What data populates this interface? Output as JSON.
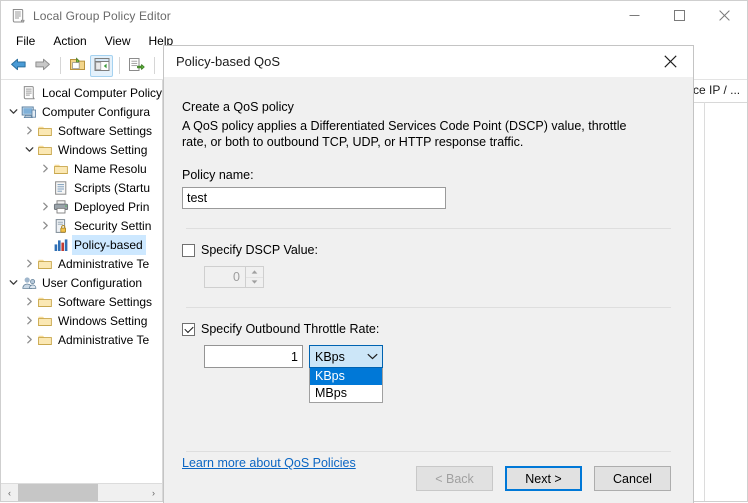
{
  "window": {
    "title": "Local Group Policy Editor",
    "icon": "policy-editor-icon",
    "controls": {
      "minimize": "minimize-icon",
      "maximize": "maximize-icon",
      "close": "close-icon"
    }
  },
  "menu": {
    "items": [
      {
        "label": "File"
      },
      {
        "label": "Action"
      },
      {
        "label": "View"
      },
      {
        "label": "Help"
      }
    ]
  },
  "toolbar": {
    "buttons": [
      {
        "name": "back-button",
        "icon": "back-arrow-icon"
      },
      {
        "name": "forward-button",
        "icon": "forward-arrow-icon"
      },
      {
        "name": "up-folder-button",
        "icon": "folder-up-icon"
      },
      {
        "name": "show-hide-console-tree-button",
        "icon": "console-tree-icon"
      },
      {
        "name": "export-list-button",
        "icon": "export-list-icon"
      },
      {
        "name": "help-button",
        "icon": "help-question-icon"
      }
    ]
  },
  "tree": {
    "items": [
      {
        "label": "Local Computer Policy",
        "indent": 0,
        "twisty": "none",
        "icon": "policy-scroll-icon",
        "selected": false
      },
      {
        "label": "Computer Configura",
        "indent": 0,
        "twisty": "expanded",
        "icon": "computer-icon",
        "selected": false
      },
      {
        "label": "Software Settings",
        "indent": 1,
        "twisty": "collapsed",
        "icon": "folder-icon",
        "selected": false
      },
      {
        "label": "Windows Setting",
        "indent": 1,
        "twisty": "expanded",
        "icon": "folder-icon",
        "selected": false
      },
      {
        "label": "Name Resolu",
        "indent": 2,
        "twisty": "collapsed",
        "icon": "folder-icon",
        "selected": false
      },
      {
        "label": "Scripts (Startu",
        "indent": 2,
        "twisty": "none",
        "icon": "scripts-icon",
        "selected": false
      },
      {
        "label": "Deployed Prin",
        "indent": 2,
        "twisty": "collapsed",
        "icon": "printer-icon",
        "selected": false
      },
      {
        "label": "Security Settin",
        "indent": 2,
        "twisty": "collapsed",
        "icon": "security-lock-icon",
        "selected": false
      },
      {
        "label": "Policy-based",
        "indent": 2,
        "twisty": "none",
        "icon": "bar-chart-icon",
        "selected": true
      },
      {
        "label": "Administrative Te",
        "indent": 1,
        "twisty": "collapsed",
        "icon": "folder-icon",
        "selected": false
      },
      {
        "label": "User Configuration",
        "indent": 0,
        "twisty": "expanded",
        "icon": "user-icon",
        "selected": false
      },
      {
        "label": "Software Settings",
        "indent": 1,
        "twisty": "collapsed",
        "icon": "folder-icon",
        "selected": false
      },
      {
        "label": "Windows Setting",
        "indent": 1,
        "twisty": "collapsed",
        "icon": "folder-icon",
        "selected": false
      },
      {
        "label": "Administrative Te",
        "indent": 1,
        "twisty": "collapsed",
        "icon": "folder-icon",
        "selected": false
      }
    ],
    "hscroll": {
      "left_arrow": "‹",
      "right_arrow": "›"
    }
  },
  "content": {
    "column_header": "rce IP / ..."
  },
  "dialog": {
    "title": "Policy-based QoS",
    "close_icon": "close-icon",
    "heading": "Create a QoS policy",
    "description": "A QoS policy applies a Differentiated Services Code Point (DSCP) value, throttle rate, or both to outbound TCP, UDP, or HTTP response traffic.",
    "policy_name": {
      "label": "Policy name:",
      "value": "test"
    },
    "dscp": {
      "checkbox_label": "Specify DSCP Value:",
      "checked": false,
      "value": "0",
      "up_icon": "spinner-up-icon",
      "down_icon": "spinner-down-icon"
    },
    "throttle": {
      "checkbox_label": "Specify Outbound Throttle Rate:",
      "checked": true,
      "value": "1",
      "unit_selected": "KBps",
      "unit_options": [
        "KBps",
        "MBps"
      ],
      "dropdown_open": true,
      "arrow_icon": "chevron-down-icon"
    },
    "link": "Learn more about QoS Policies",
    "buttons": {
      "back": "< Back",
      "next": "Next >",
      "cancel": "Cancel"
    }
  },
  "colors": {
    "accent_blue": "#0078d7",
    "combo_border": "#0063b1",
    "combo_fill": "#cce6f8",
    "link": "#0b66c3",
    "dialog_bg": "#f0f0f0",
    "tree_selection": "#cde8ff"
  }
}
